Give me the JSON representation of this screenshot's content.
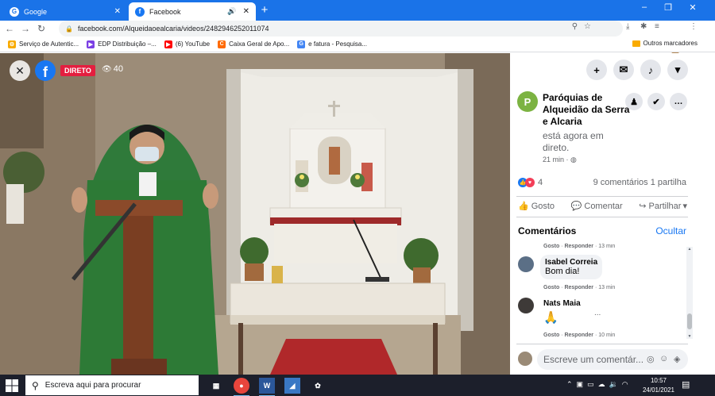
{
  "browser": {
    "tabs": [
      {
        "title": "Google",
        "favicon": "G",
        "active": false
      },
      {
        "title": "Facebook",
        "favicon": "f",
        "active": true
      }
    ],
    "new_tab_symbol": "+",
    "window_controls": [
      "–",
      "❐",
      "✕"
    ],
    "url": "facebook.com/Alqueidaoealcaria/videos/2482946252011074",
    "bookmarks": [
      {
        "label": "Serviço de Autentic...",
        "color": "#f9ab00",
        "glyph": "⚙"
      },
      {
        "label": "EDP Distribuição –...",
        "color": "#7b3fe4",
        "glyph": "▶"
      },
      {
        "label": "(6) YouTube",
        "color": "#ff0000",
        "glyph": "▶"
      },
      {
        "label": "Caixa Geral de Apo...",
        "color": "#ff6a00",
        "glyph": "C"
      },
      {
        "label": "e fatura - Pesquisa...",
        "color": "#4285f4",
        "glyph": "G"
      }
    ],
    "other_bookmarks": "Outros marcadores"
  },
  "video": {
    "live_label": "DIRETO",
    "viewer_count": "40"
  },
  "page": {
    "avatar_letter": "P",
    "name": "Paróquias de Alqueidão da Serra e Alcaria",
    "status": "está agora em direto.",
    "time": "21 min ·",
    "reaction_count": "4",
    "comments_count": "9 comentários",
    "shares_count": "1 partilha"
  },
  "actions": {
    "like": "Gosto",
    "comment": "Comentar",
    "share": "Partilhar"
  },
  "comments_section": {
    "title": "Comentários",
    "hide": "Ocultar",
    "items": [
      {
        "meta_like": "Gosto",
        "meta_reply": "Responder",
        "meta_time": "13 min"
      },
      {
        "author": "Isabel Correia",
        "text": "Bom dia!",
        "meta_like": "Gosto",
        "meta_reply": "Responder",
        "meta_time": "13 min"
      },
      {
        "author": "Nats Maia",
        "text": "🙏",
        "more": "...",
        "meta_like": "Gosto",
        "meta_reply": "Responder",
        "meta_time": "10 min"
      }
    ],
    "composer_placeholder": "Escreve um comentár..."
  },
  "taskbar": {
    "search_placeholder": "Escreva aqui para procurar",
    "time": "10:57",
    "date": "24/01/2021"
  },
  "colors": {
    "chrome_blue": "#1a73e8",
    "facebook_blue": "#1877f2",
    "live_red": "#e41e3f",
    "taskbar": "#1c1f2b"
  }
}
